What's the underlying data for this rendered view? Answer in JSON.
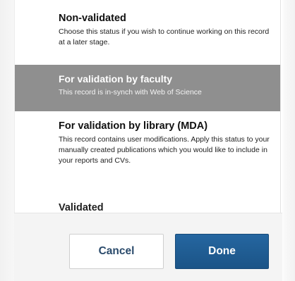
{
  "status_options": [
    {
      "title": "Non-validated",
      "description": "Choose this status if you wish to continue working on this record at a later stage.",
      "selected": false
    },
    {
      "title": "For validation by faculty",
      "description": "This record is in-synch with Web of Science",
      "selected": true
    },
    {
      "title": "For validation by library (MDA)",
      "description": "This record contains user modifications. Apply this status to your manually created publications which you would like to include in your reports and CVs.",
      "selected": false
    },
    {
      "title": "Validated",
      "description": "",
      "selected": false
    }
  ],
  "footer": {
    "cancel_label": "Cancel",
    "done_label": "Done"
  },
  "colors": {
    "selected_row": "#8f8f8f",
    "done_button": "#1f5a8f",
    "cancel_text": "#2a4a6b"
  }
}
